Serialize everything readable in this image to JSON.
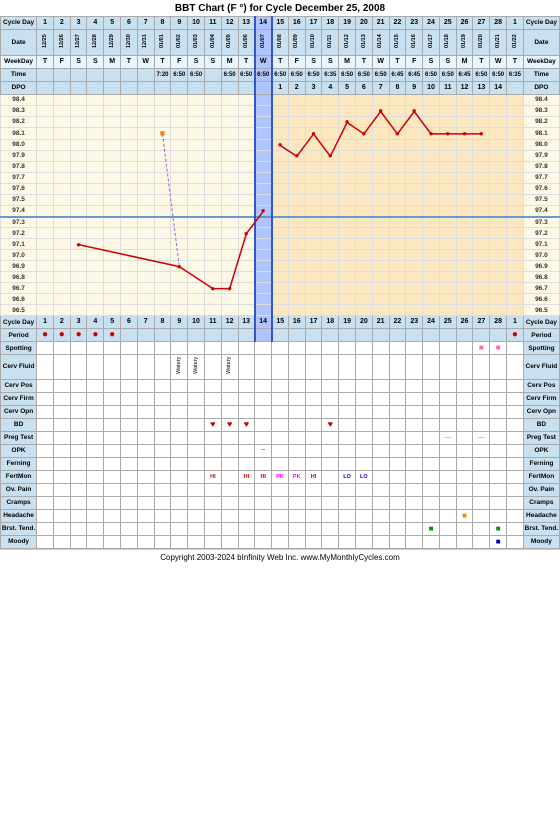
{
  "title": "BBT Chart (F °) for Cycle December 25, 2008",
  "cycle_days": [
    "1",
    "2",
    "3",
    "4",
    "5",
    "6",
    "7",
    "8",
    "9",
    "10",
    "11",
    "12",
    "13",
    "14",
    "15",
    "16",
    "17",
    "18",
    "19",
    "20",
    "21",
    "22",
    "23",
    "24",
    "25",
    "26",
    "27",
    "28",
    "1"
  ],
  "dates": [
    "12/25",
    "12/26",
    "12/27",
    "12/28",
    "12/29",
    "12/30",
    "12/31",
    "01/01",
    "01/02",
    "01/03",
    "01/04",
    "01/05",
    "01/06",
    "01/07",
    "01/08",
    "01/09",
    "01/10",
    "01/11",
    "01/12",
    "01/13",
    "01/14",
    "01/15",
    "01/16",
    "01/17",
    "01/18",
    "01/19",
    "01/20",
    "01/21",
    "01/22"
  ],
  "weekdays": [
    "T",
    "F",
    "S",
    "S",
    "M",
    "T",
    "W",
    "T",
    "F",
    "S",
    "S",
    "M",
    "T",
    "W",
    "T",
    "F",
    "S",
    "S",
    "M",
    "T",
    "W",
    "T",
    "F",
    "S",
    "S",
    "M",
    "T",
    "W",
    "T"
  ],
  "times": [
    "",
    "",
    "",
    "",
    "",
    "",
    "",
    "7:20",
    "6:50",
    "6:50",
    "",
    "6:50",
    "6:50",
    "6:50",
    "6:50",
    "6:50",
    "6:50",
    "6:35",
    "6:50",
    "6:50",
    "6:50",
    "6:45",
    "6:45",
    "6:50",
    "6:50",
    "6:45",
    "6:50",
    "6:50",
    "6:35"
  ],
  "dpo": [
    "",
    "",
    "",
    "",
    "",
    "",
    "",
    "",
    "",
    "",
    "",
    "",
    "",
    "",
    "1",
    "2",
    "3",
    "4",
    "5",
    "6",
    "7",
    "8",
    "9",
    "10",
    "11",
    "12",
    "13",
    "14",
    ""
  ],
  "bbt_temps": {
    "98.4": [
      false,
      false,
      false,
      false,
      false,
      false,
      false,
      false,
      false,
      false,
      false,
      false,
      false,
      false,
      false,
      false,
      false,
      false,
      false,
      false,
      false,
      false,
      false,
      false,
      false,
      false,
      false,
      false,
      false
    ],
    "98.3": [
      false,
      false,
      false,
      false,
      false,
      false,
      false,
      false,
      false,
      false,
      false,
      false,
      false,
      false,
      false,
      false,
      false,
      false,
      false,
      false,
      false,
      true,
      false,
      true,
      false,
      false,
      false,
      false,
      false
    ],
    "98.2": [
      false,
      false,
      false,
      false,
      false,
      false,
      false,
      false,
      false,
      false,
      false,
      false,
      false,
      false,
      false,
      false,
      false,
      false,
      false,
      true,
      false,
      false,
      false,
      false,
      false,
      false,
      false,
      false,
      false
    ],
    "98.1": [
      false,
      false,
      false,
      false,
      false,
      false,
      false,
      false,
      true,
      false,
      false,
      false,
      false,
      false,
      false,
      false,
      true,
      false,
      false,
      false,
      false,
      false,
      false,
      false,
      false,
      true,
      true,
      true,
      true
    ],
    "98.0": [
      false,
      false,
      false,
      false,
      false,
      false,
      false,
      false,
      false,
      false,
      false,
      false,
      false,
      false,
      true,
      true,
      false,
      true,
      false,
      false,
      true,
      false,
      true,
      false,
      true,
      false,
      false,
      false,
      false
    ],
    "97.9": [
      false,
      false,
      false,
      false,
      false,
      false,
      false,
      false,
      false,
      false,
      false,
      false,
      false,
      false,
      false,
      false,
      false,
      false,
      false,
      false,
      false,
      false,
      false,
      false,
      false,
      false,
      false,
      false,
      false
    ],
    "97.8": [
      false,
      false,
      false,
      false,
      false,
      false,
      false,
      false,
      false,
      false,
      false,
      false,
      false,
      false,
      false,
      false,
      false,
      false,
      false,
      false,
      false,
      false,
      false,
      false,
      false,
      false,
      false,
      false,
      false
    ],
    "97.7": [
      false,
      false,
      false,
      false,
      false,
      false,
      false,
      false,
      false,
      false,
      false,
      false,
      false,
      false,
      false,
      false,
      false,
      false,
      false,
      false,
      false,
      false,
      false,
      false,
      false,
      false,
      false,
      false,
      false
    ],
    "97.6": [
      false,
      false,
      false,
      false,
      false,
      false,
      false,
      false,
      false,
      false,
      false,
      false,
      false,
      false,
      false,
      false,
      false,
      false,
      false,
      false,
      false,
      false,
      false,
      false,
      false,
      false,
      false,
      false,
      false
    ],
    "97.5": [
      false,
      false,
      false,
      false,
      false,
      false,
      false,
      false,
      false,
      false,
      false,
      false,
      false,
      false,
      false,
      false,
      false,
      false,
      false,
      false,
      false,
      false,
      false,
      false,
      false,
      false,
      false,
      false,
      false
    ],
    "97.4": [
      false,
      false,
      false,
      false,
      false,
      false,
      false,
      false,
      false,
      false,
      false,
      false,
      false,
      false,
      false,
      false,
      false,
      false,
      false,
      false,
      false,
      false,
      false,
      false,
      false,
      false,
      false,
      false,
      false
    ],
    "97.3": [
      false,
      false,
      false,
      false,
      false,
      false,
      false,
      false,
      false,
      false,
      false,
      false,
      false,
      false,
      false,
      false,
      false,
      false,
      false,
      false,
      false,
      false,
      false,
      false,
      false,
      false,
      false,
      false,
      false
    ],
    "97.2": [
      false,
      false,
      false,
      false,
      false,
      false,
      false,
      false,
      false,
      false,
      false,
      false,
      true,
      false,
      false,
      false,
      false,
      false,
      false,
      false,
      false,
      false,
      false,
      false,
      false,
      false,
      false,
      false,
      false
    ],
    "97.1": [
      false,
      false,
      true,
      false,
      false,
      false,
      false,
      false,
      false,
      false,
      false,
      false,
      false,
      false,
      false,
      false,
      false,
      false,
      false,
      false,
      false,
      false,
      false,
      false,
      false,
      false,
      false,
      false,
      false
    ],
    "97.0": [
      false,
      false,
      false,
      false,
      false,
      false,
      false,
      false,
      false,
      false,
      false,
      false,
      false,
      false,
      false,
      false,
      false,
      false,
      false,
      false,
      false,
      false,
      false,
      false,
      false,
      false,
      false,
      false,
      false
    ],
    "96.9": [
      false,
      false,
      false,
      false,
      false,
      false,
      false,
      false,
      false,
      false,
      false,
      false,
      false,
      false,
      false,
      false,
      false,
      false,
      false,
      false,
      false,
      false,
      false,
      false,
      false,
      false,
      false,
      false,
      false
    ],
    "96.8": [
      false,
      false,
      false,
      false,
      false,
      false,
      false,
      false,
      false,
      false,
      false,
      false,
      false,
      false,
      false,
      false,
      false,
      false,
      false,
      false,
      false,
      false,
      false,
      false,
      false,
      false,
      false,
      false,
      false
    ],
    "96.7": [
      false,
      false,
      false,
      false,
      false,
      false,
      false,
      false,
      false,
      false,
      true,
      true,
      false,
      false,
      false,
      false,
      false,
      false,
      false,
      false,
      false,
      false,
      false,
      false,
      false,
      false,
      false,
      false,
      false
    ],
    "96.6": [
      false,
      false,
      false,
      false,
      false,
      false,
      false,
      false,
      false,
      false,
      false,
      false,
      false,
      false,
      false,
      false,
      false,
      false,
      false,
      false,
      false,
      false,
      false,
      false,
      false,
      false,
      false,
      false,
      false
    ],
    "96.5": [
      false,
      false,
      false,
      false,
      false,
      false,
      false,
      false,
      false,
      false,
      false,
      false,
      false,
      false,
      false,
      false,
      false,
      false,
      false,
      false,
      false,
      false,
      false,
      false,
      false,
      false,
      false,
      false,
      false
    ]
  },
  "temp_labels": [
    "98.4",
    "98.3",
    "98.2",
    "98.1",
    "98.0",
    "97.9",
    "97.8",
    "97.7",
    "97.6",
    "97.5",
    "97.4",
    "97.3",
    "97.2",
    "97.1",
    "97.0",
    "96.9",
    "96.8",
    "96.7",
    "96.6",
    "96.5"
  ],
  "period_dots": [
    true,
    true,
    true,
    true,
    true,
    false,
    false,
    false,
    false,
    false,
    false,
    false,
    false,
    false,
    false,
    false,
    false,
    false,
    false,
    false,
    false,
    false,
    false,
    false,
    false,
    false,
    false,
    false,
    true
  ],
  "spotting": [
    false,
    false,
    false,
    false,
    false,
    false,
    false,
    false,
    false,
    false,
    false,
    false,
    false,
    false,
    false,
    false,
    false,
    false,
    false,
    false,
    false,
    false,
    false,
    false,
    false,
    false,
    true,
    true,
    false
  ],
  "cerv_fluid": [
    "",
    "",
    "",
    "",
    "",
    "",
    "",
    "",
    "Watery",
    "Watery",
    "",
    "Watery",
    "",
    "",
    "",
    "",
    "",
    "",
    "",
    "",
    "",
    "",
    "",
    "",
    "",
    "",
    "",
    "",
    ""
  ],
  "bd": [
    false,
    false,
    false,
    false,
    false,
    false,
    false,
    false,
    false,
    false,
    true,
    true,
    true,
    false,
    false,
    false,
    false,
    true,
    false,
    false,
    false,
    false,
    false,
    false,
    false,
    false,
    false,
    false,
    false
  ],
  "preg_test": [
    false,
    false,
    false,
    false,
    false,
    false,
    false,
    false,
    false,
    false,
    false,
    false,
    false,
    false,
    false,
    false,
    false,
    false,
    false,
    false,
    false,
    false,
    false,
    false,
    true,
    false,
    true,
    false,
    false
  ],
  "opk": [
    false,
    false,
    false,
    false,
    false,
    false,
    false,
    false,
    false,
    false,
    false,
    false,
    false,
    true,
    false,
    false,
    false,
    false,
    false,
    false,
    false,
    false,
    false,
    false,
    false,
    false,
    false,
    false,
    false
  ],
  "fertmon_labels": [
    "",
    "",
    "",
    "",
    "",
    "",
    "",
    "",
    "",
    "",
    "HI",
    "",
    "HI",
    "HI",
    "PK",
    "PK",
    "HI",
    "",
    "LO",
    "LO",
    "",
    "",
    "",
    "",
    "",
    "",
    "",
    "",
    ""
  ],
  "headache": [
    false,
    false,
    false,
    false,
    false,
    false,
    false,
    false,
    false,
    false,
    false,
    false,
    false,
    false,
    false,
    false,
    false,
    false,
    false,
    false,
    false,
    false,
    false,
    false,
    false,
    true,
    false,
    false,
    false
  ],
  "brst_tend": [
    false,
    false,
    false,
    false,
    false,
    false,
    false,
    false,
    false,
    false,
    false,
    false,
    false,
    false,
    false,
    false,
    false,
    false,
    false,
    false,
    false,
    false,
    false,
    true,
    false,
    false,
    false,
    true,
    false
  ],
  "moody": [
    false,
    false,
    false,
    false,
    false,
    false,
    false,
    false,
    false,
    false,
    false,
    false,
    false,
    false,
    false,
    false,
    false,
    false,
    false,
    false,
    false,
    false,
    false,
    false,
    false,
    false,
    false,
    true,
    false
  ],
  "ovulation_col": 14,
  "coverline_temp": "97.3",
  "footer": "Copyright 2003-2024 bInfinity Web Inc.    www.MyMonthlyCycles.com",
  "labels": {
    "cycle_day": "Cycle Day",
    "date": "Date",
    "weekday": "WeekDay",
    "time": "Time",
    "dpo": "DPO",
    "period": "Period",
    "spotting": "Spotting",
    "cerv_fluid": "Cerv Fluid",
    "cerv_pos": "Cerv Pos",
    "cerv_firm": "Cerv Firm",
    "cerv_opn": "Cerv Opn",
    "bd": "BD",
    "preg_test": "Preg Test",
    "opk": "OPK",
    "ferning": "Ferning",
    "fertmon": "FertMon",
    "ov_pain": "Ov. Pain",
    "cramps": "Cramps",
    "headache": "Headache",
    "brst_tend": "Brst. Tend.",
    "moody": "Moody"
  }
}
